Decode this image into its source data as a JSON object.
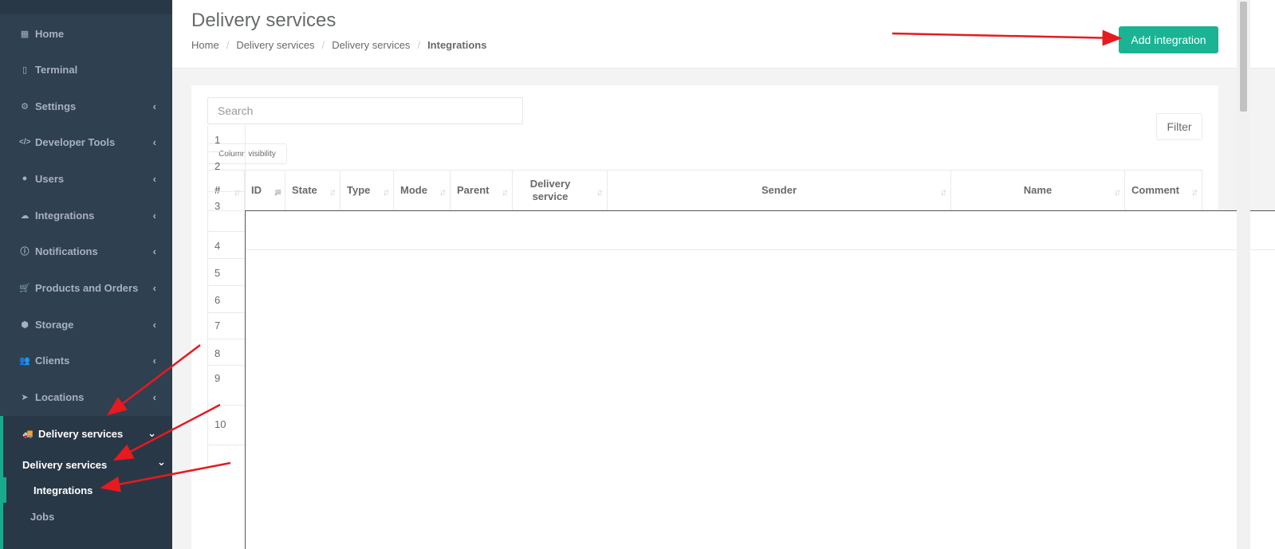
{
  "sidebar": {
    "items": [
      {
        "label": "Home",
        "icon": "grid-icon",
        "glyph": "▦",
        "chevron": ""
      },
      {
        "label": "Terminal",
        "icon": "tablet-icon",
        "glyph": "▯",
        "chevron": ""
      },
      {
        "label": "Settings",
        "icon": "gear-icon",
        "glyph": "⚙",
        "chevron": "‹"
      },
      {
        "label": "Developer Tools",
        "icon": "code-icon",
        "glyph": "</>",
        "chevron": "‹"
      },
      {
        "label": "Users",
        "icon": "user-icon",
        "glyph": "●",
        "chevron": "‹"
      },
      {
        "label": "Integrations",
        "icon": "cloud-download-icon",
        "glyph": "☁",
        "chevron": "‹"
      },
      {
        "label": "Notifications",
        "icon": "info-circle-icon",
        "glyph": "ⓘ",
        "chevron": "‹"
      },
      {
        "label": "Products and Orders",
        "icon": "cart-icon",
        "glyph": "🛒",
        "chevron": "‹"
      },
      {
        "label": "Storage",
        "icon": "cubes-icon",
        "glyph": "⬢",
        "chevron": "‹"
      },
      {
        "label": "Clients",
        "icon": "users-icon",
        "glyph": "👥",
        "chevron": "‹"
      },
      {
        "label": "Locations",
        "icon": "location-arrow-icon",
        "glyph": "➤",
        "chevron": "‹"
      }
    ],
    "active_item": {
      "label": "Delivery services",
      "icon": "truck-icon",
      "glyph": "🚚",
      "chevron": "⌄"
    },
    "sub_group": {
      "label": "Delivery services",
      "chevron": "⌄"
    },
    "sub_items": [
      {
        "label": "Integrations"
      },
      {
        "label": "Jobs"
      }
    ]
  },
  "header": {
    "title": "Delivery services",
    "breadcrumb": [
      "Home",
      "Delivery services",
      "Delivery services",
      "Integrations"
    ],
    "breadcrumb_sep": "/",
    "add_button": "Add integration"
  },
  "toolbar": {
    "search_placeholder": "Search",
    "filter_label": "Filter",
    "column_visibility_label": "Column visibility"
  },
  "table": {
    "columns": [
      {
        "label": "#",
        "sort": "both"
      },
      {
        "label": "ID",
        "sort": "desc"
      },
      {
        "label": "State",
        "sort": "both"
      },
      {
        "label": "Type",
        "sort": "both"
      },
      {
        "label": "Mode",
        "sort": "both"
      },
      {
        "label": "Parent",
        "sort": "both"
      },
      {
        "label": "Delivery service",
        "sort": "both"
      },
      {
        "label": "Sender",
        "sort": "both"
      },
      {
        "label": "Name",
        "sort": "both"
      },
      {
        "label": "Comment",
        "sort": "both"
      }
    ],
    "row_numbers": [
      "1",
      "2",
      "3",
      "4",
      "5",
      "6",
      "7",
      "8",
      "9",
      "10"
    ]
  },
  "colors": {
    "sidebar_bg": "#2f4050",
    "sidebar_active_bg": "#293846",
    "accent": "#1ab394",
    "annotation_arrow": "#e8191f"
  }
}
